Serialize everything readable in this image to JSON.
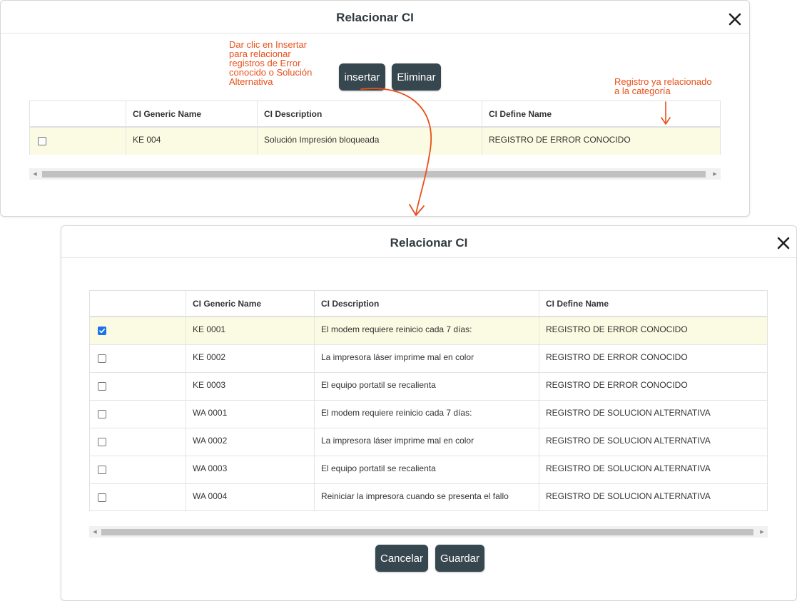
{
  "top_dialog": {
    "title": "Relacionar CI",
    "insert_button": "insertar",
    "delete_button": "Eliminar",
    "columns": [
      "",
      "CI Generic Name",
      "CI Description",
      "CI Define Name"
    ],
    "rows": [
      {
        "checked": false,
        "generic_name": "KE 004",
        "description": "Solución Impresión bloqueada",
        "define_name": "REGISTRO DE ERROR CONOCIDO"
      }
    ]
  },
  "bottom_dialog": {
    "title": "Relacionar CI",
    "cancel_button": "Cancelar",
    "save_button": "Guardar",
    "columns": [
      "",
      "CI Generic Name",
      "CI Description",
      "CI Define Name"
    ],
    "rows": [
      {
        "checked": true,
        "generic_name": "KE 0001",
        "description": "El modem requiere reinicio cada 7 días:",
        "define_name": "REGISTRO DE ERROR CONOCIDO"
      },
      {
        "checked": false,
        "generic_name": "KE 0002",
        "description": "La impresora láser imprime mal en color",
        "define_name": "REGISTRO DE ERROR CONOCIDO"
      },
      {
        "checked": false,
        "generic_name": "KE 0003",
        "description": "El equipo portatil se recalienta",
        "define_name": "REGISTRO DE ERROR CONOCIDO"
      },
      {
        "checked": false,
        "generic_name": "WA 0001",
        "description": "El modem requiere reinicio cada 7 días:",
        "define_name": "REGISTRO DE SOLUCION ALTERNATIVA"
      },
      {
        "checked": false,
        "generic_name": "WA 0002",
        "description": "La impresora láser imprime mal en color",
        "define_name": "REGISTRO DE SOLUCION ALTERNATIVA"
      },
      {
        "checked": false,
        "generic_name": "WA 0003",
        "description": "El equipo portatil se recalienta",
        "define_name": "REGISTRO DE SOLUCION ALTERNATIVA"
      },
      {
        "checked": false,
        "generic_name": "WA 0004",
        "description": "Reiniciar la impresora cuando se presenta el fallo",
        "define_name": "REGISTRO DE SOLUCION ALTERNATIVA"
      }
    ]
  },
  "annotations": {
    "insert_hint": "Dar clic en Insertar\npara relacionar\nregistros de Error\nconocido o Solución\nAlternativa",
    "related_hint": "Registro ya relacionado\na la categoría"
  },
  "colors": {
    "annotation": "#e8501a",
    "button": "#37474f",
    "selected_row": "#fbfbe3",
    "checkbox_checked": "#1a73e8"
  },
  "icons": {
    "close": "close-icon",
    "checkmark": "checkmark-icon",
    "scroll_left": "scroll-left-arrow-icon",
    "scroll_right": "scroll-right-arrow-icon"
  }
}
